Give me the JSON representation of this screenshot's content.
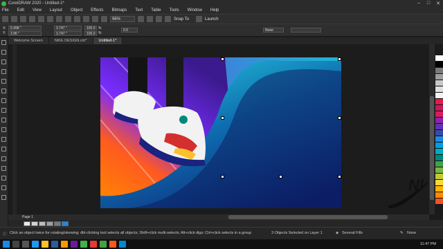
{
  "window": {
    "title": "CorelDRAW 2020 - Untitled-1*"
  },
  "menu": [
    "File",
    "Edit",
    "View",
    "Layout",
    "Object",
    "Effects",
    "Bitmaps",
    "Text",
    "Table",
    "Tools",
    "Window",
    "Help"
  ],
  "toolbar": {
    "zoom": "96%",
    "snap_to": "Snap To",
    "launch": "Launch"
  },
  "propbar": {
    "x": "5.998 \"",
    "y": "2.96 \"",
    "w": "3.747 \"",
    "h": "3.747 \"",
    "sx": "100.0",
    "sy": "100.0",
    "pct": "%",
    "angle": "0.0",
    "outline": "None"
  },
  "tabs": [
    "Welcome Screen",
    "NIKE DESIGN.cdr*",
    "Untitled-1*"
  ],
  "page": {
    "label": "Page 1"
  },
  "status": {
    "hint": "Click an object twice for rotating/skewing; dbl-clicking tool selects all objects; Shift+click multi-selects; Alt+click digs; Ctrl+click selects in a group",
    "selection": "3 Objects Selected on Layer 1",
    "fill": "Several Fills",
    "outline": "None"
  },
  "taskbar": {
    "time": "11:47 PM",
    "date": ""
  },
  "palette_colors": [
    "#ffffff",
    "#000000",
    "#7a7a7a",
    "#9e9e9e",
    "#c8c8c8",
    "#e0e0e0",
    "#f2f2f2",
    "#e6194b",
    "#c81a59",
    "#d81b60",
    "#8e24aa",
    "#5e35b1",
    "#3949ab",
    "#1e88e5",
    "#039be5",
    "#00acc1",
    "#00897b",
    "#43a047",
    "#7cb342",
    "#c0ca33",
    "#fdd835",
    "#ffb300",
    "#fb8c00",
    "#f4511e"
  ],
  "colors": {
    "accent": "#3fb24a",
    "bg": "#1b1b1b"
  }
}
